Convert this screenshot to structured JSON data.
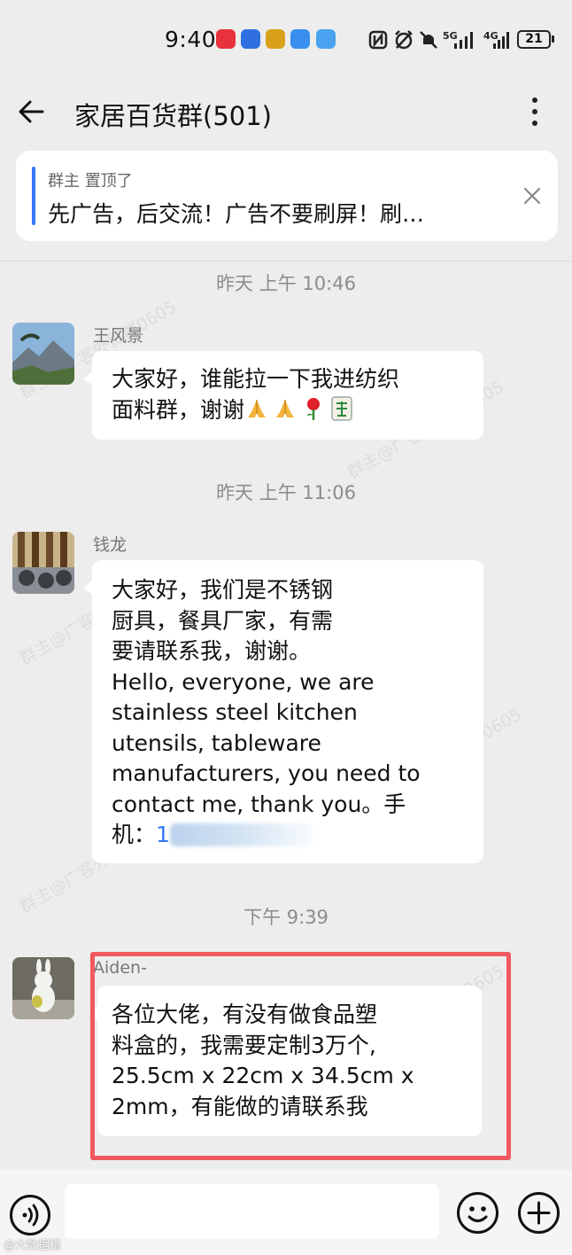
{
  "status_bar": {
    "time": "9:40",
    "battery": "21",
    "network_1": "5G",
    "network_2": "4G",
    "icons": [
      "app-badge-red-icon",
      "app-badge-blue-icon",
      "app-badge-yellow-icon",
      "cloud-icon",
      "weather-icon",
      "nfc-icon",
      "alarm-icon",
      "mute-icon",
      "signal-icon",
      "battery-icon"
    ]
  },
  "header": {
    "title": "家居百货群(501)",
    "back_icon": "arrow-left-icon",
    "more_icon": "more-vertical-icon"
  },
  "pinned": {
    "meta": "群主 置顶了",
    "text": "先广告，后交流！广告不要刷屏！刷…",
    "close_icon": "close-icon"
  },
  "watermark": "群主@广客外贸群0605",
  "messages": [
    {
      "timestamp": "昨天  上午 10:46",
      "sender": "王风景",
      "lines": [
        "大家好，谁能拉一下我进纺织",
        "面料群，谢谢"
      ],
      "emojis": [
        "folded-hands-icon",
        "folded-hands-icon",
        "rose-icon",
        "mahjong-fa-icon"
      ]
    },
    {
      "timestamp": "昨天  上午 11:06",
      "sender": "钱龙",
      "lines": [
        "大家好，我们是不锈钢",
        "厨具，餐具厂家，有需",
        "要请联系我，谢谢。",
        "Hello, everyone, we are",
        "stainless steel kitchen",
        "utensils, tableware",
        "manufacturers, you need to",
        "contact me, thank you。手"
      ],
      "phone_prefix": "机：",
      "phone_visible": "1"
    },
    {
      "timestamp": "下午 9:39",
      "sender": "Aiden-",
      "lines": [
        "各位大佬，有没有做食品塑",
        "料盒的，我需要定制3万个,",
        "25.5cm x 22cm x 34.5cm x",
        "2mm，有能做的请联系我"
      ]
    }
  ],
  "bottom_bar": {
    "voice_icon": "voice-icon",
    "emoji_icon": "smiley-icon",
    "plus_icon": "plus-icon",
    "input_value": ""
  },
  "footer_mark": "@大数据猎",
  "colors": {
    "background": "#ededed",
    "bubble": "#ffffff",
    "accent": "#3478f6",
    "highlight": "#f05a5e"
  }
}
